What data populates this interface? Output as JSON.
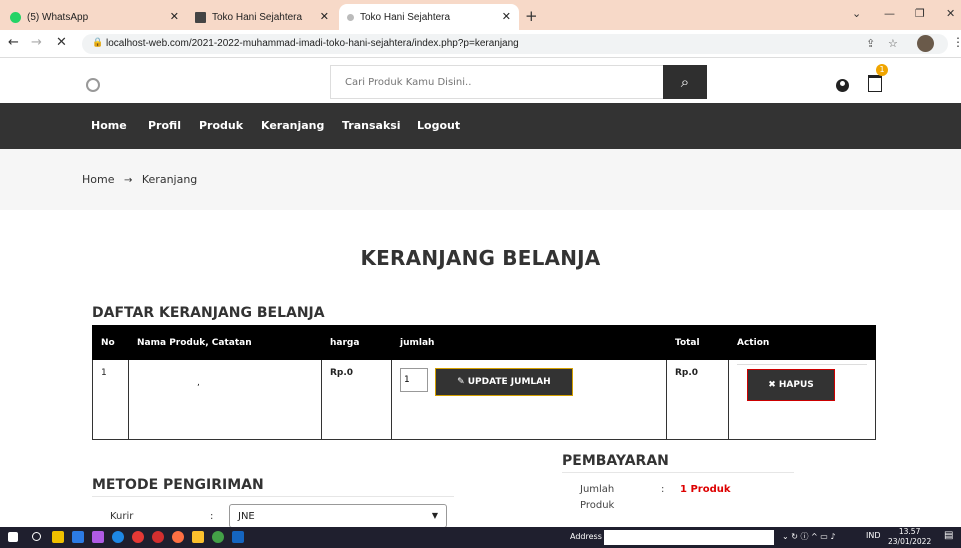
{
  "browser": {
    "tabs": [
      {
        "title": "(5) WhatsApp",
        "favicon_color": "#25d366"
      },
      {
        "title": "Toko Hani Sejahtera",
        "favicon_color": "#444444"
      },
      {
        "title": "Toko Hani Sejahtera",
        "favicon_color": "#bbbbbb",
        "active": true
      }
    ],
    "new_tab": "+",
    "url": "localhost-web.com/2021-2022-muhammad-imadi-toko-hani-sejahtera/index.php?p=keranjang",
    "window_controls": [
      "⌄",
      "—",
      "❐",
      "✕"
    ]
  },
  "header": {
    "search_placeholder": "Cari Produk Kamu Disini..",
    "search_icon": "search-icon",
    "cart_count": "1"
  },
  "nav": {
    "items": [
      "Home",
      "Profil",
      "Produk",
      "Keranjang",
      "Transaksi",
      "Logout"
    ]
  },
  "breadcrumb": {
    "home": "Home",
    "separator": "→",
    "current": "Keranjang"
  },
  "page_title": "KERANJANG BELANJA",
  "cart": {
    "title": "DAFTAR KERANJANG BELANJA",
    "columns": [
      "No",
      "Nama Produk, Catatan",
      "harga",
      "jumlah",
      "Total",
      "Action"
    ],
    "rows": [
      {
        "no": "1",
        "name": ",",
        "price": "Rp.0",
        "qty": "1",
        "total": "Rp.0"
      }
    ],
    "update_label": "UPDATE JUMLAH",
    "update_icon": "✎",
    "delete_label": "HAPUS",
    "delete_icon": "✖"
  },
  "shipping": {
    "title": "METODE PENGIRIMAN",
    "courier_label": "Kurir",
    "colon": ":",
    "courier_value": "JNE"
  },
  "payment": {
    "title": "PEMBAYARAN",
    "qty_label_1": "Jumlah",
    "qty_label_2": "Produk",
    "colon": ":",
    "qty_value": "1 Produk"
  },
  "taskbar": {
    "address_label": "Address",
    "language": "IND",
    "time": "13.57",
    "date": "23/01/2022"
  },
  "colors": {
    "nav_bg": "#333333",
    "price_green": "#1a8a1a",
    "accent_red": "#dd0000",
    "cart_badge": "#f0a500"
  }
}
